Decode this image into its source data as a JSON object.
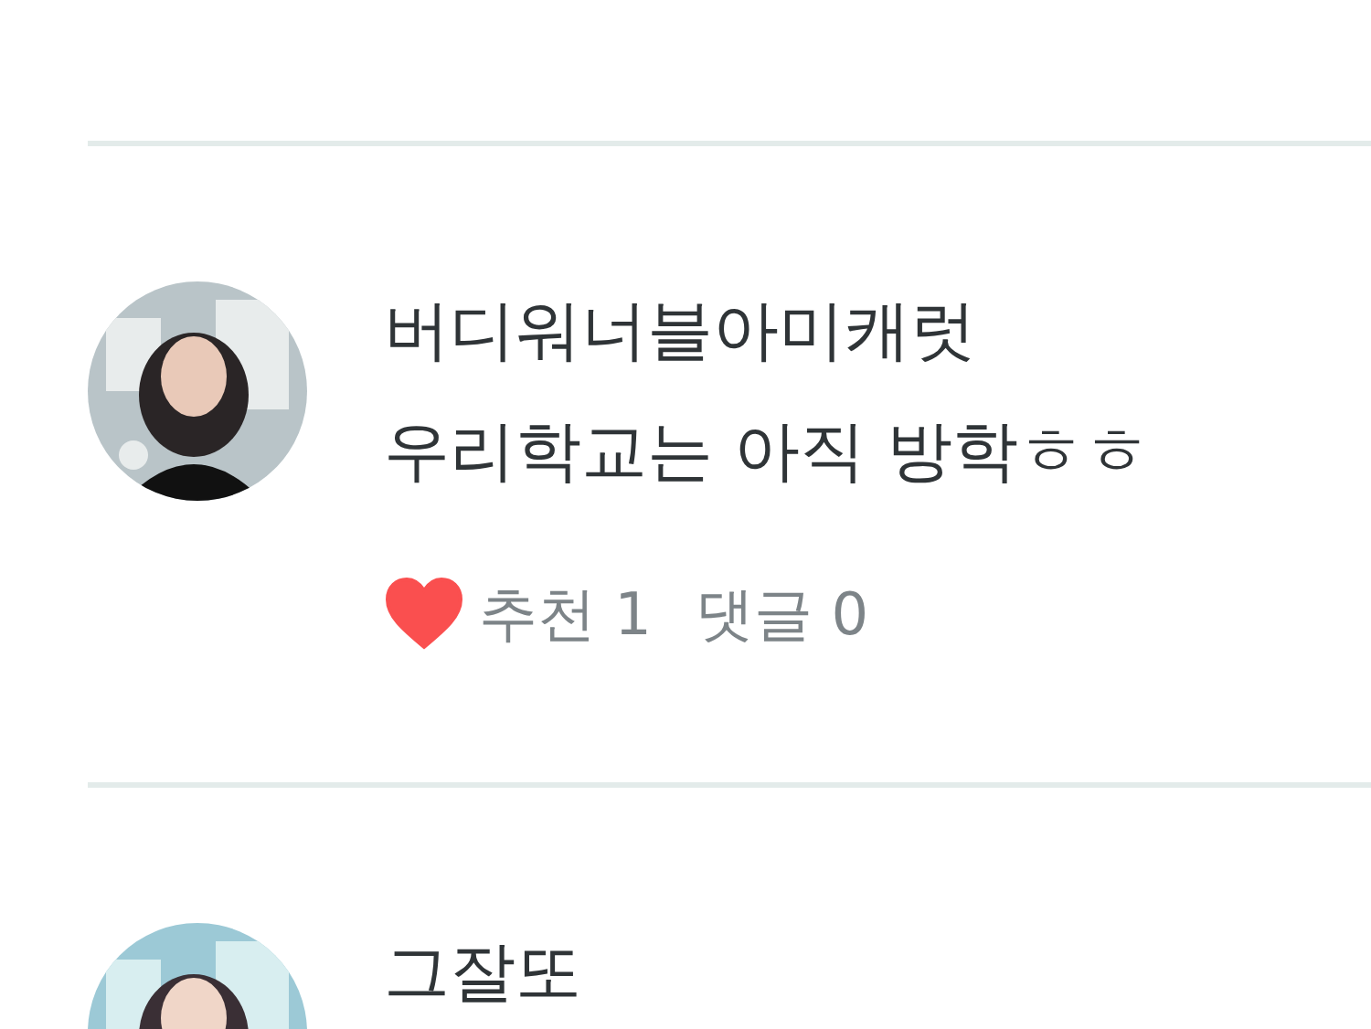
{
  "posts": [
    {
      "author": "버디워너블아미캐럿",
      "text": "우리학교는 아직 방학ㅎㅎ",
      "liked": true,
      "likes": "추천 1",
      "comments": "댓글 0"
    },
    {
      "author": "그잘또"
    }
  ]
}
